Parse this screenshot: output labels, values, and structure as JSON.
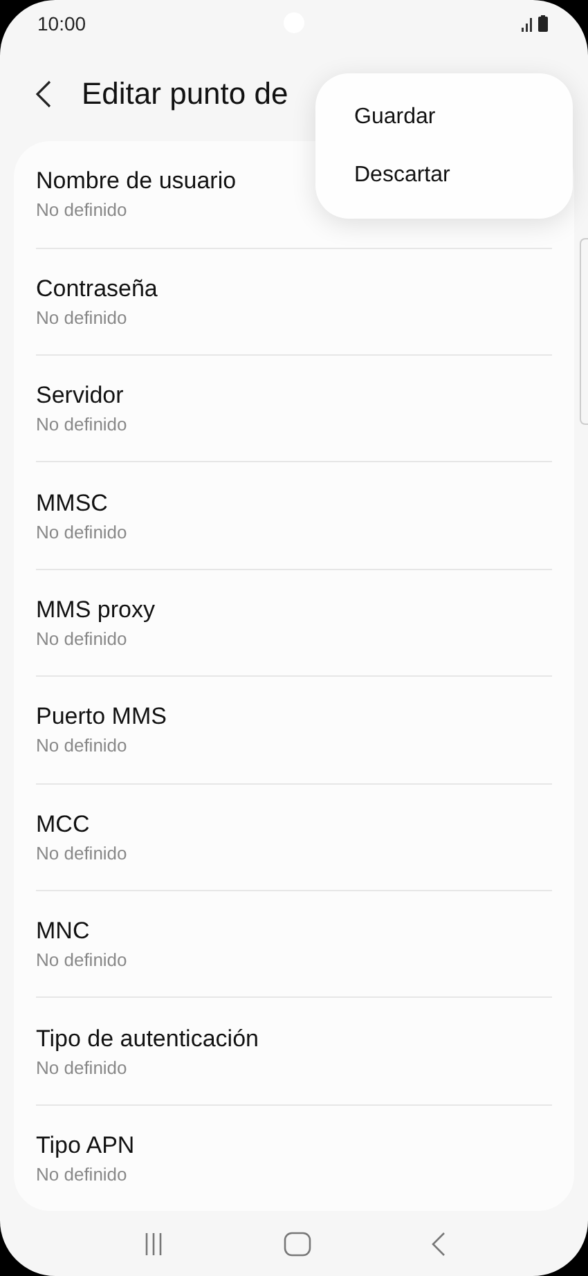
{
  "status_bar": {
    "time": "10:00"
  },
  "header": {
    "title": "Editar punto de"
  },
  "menu": {
    "items": [
      "Guardar",
      "Descartar"
    ]
  },
  "settings": [
    {
      "label": "Nombre de usuario",
      "value": "No definido"
    },
    {
      "label": "Contraseña",
      "value": "No definido"
    },
    {
      "label": "Servidor",
      "value": "No definido"
    },
    {
      "label": "MMSC",
      "value": "No definido"
    },
    {
      "label": "MMS proxy",
      "value": "No definido"
    },
    {
      "label": "Puerto MMS",
      "value": "No definido"
    },
    {
      "label": "MCC",
      "value": "No definido"
    },
    {
      "label": "MNC",
      "value": "No definido"
    },
    {
      "label": "Tipo de autenticación",
      "value": "No definido"
    },
    {
      "label": "Tipo APN",
      "value": "No definido"
    }
  ]
}
